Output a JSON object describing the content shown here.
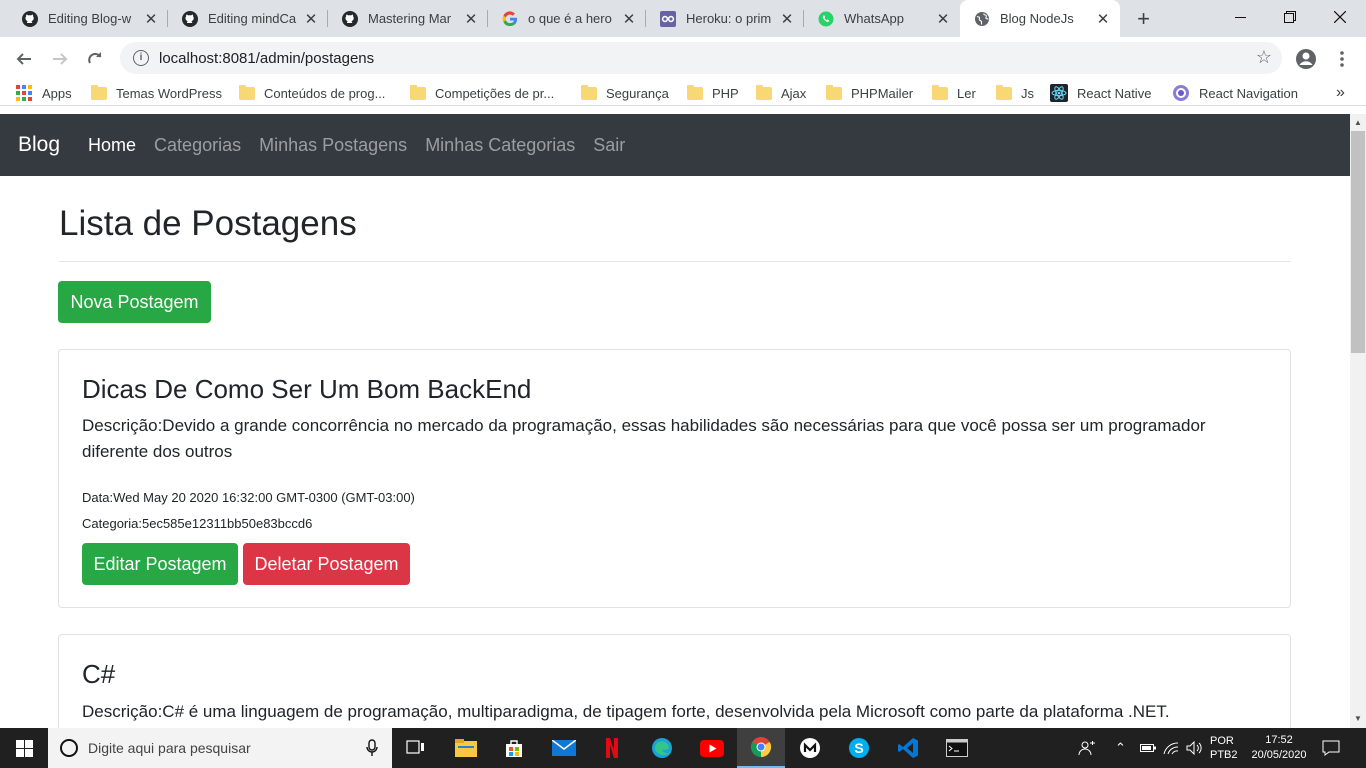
{
  "browser": {
    "tabs": [
      {
        "title": "Editing Blog-w",
        "icon": "github-icon",
        "active": false
      },
      {
        "title": "Editing mindCa",
        "icon": "github-icon",
        "active": false
      },
      {
        "title": "Mastering Mar",
        "icon": "github-icon",
        "active": false
      },
      {
        "title": "o que é a hero",
        "icon": "google-icon",
        "active": false
      },
      {
        "title": "Heroku: o prim",
        "icon": "heroku-icon",
        "active": false
      },
      {
        "title": "WhatsApp",
        "icon": "whatsapp-icon",
        "active": false
      },
      {
        "title": "Blog NodeJs",
        "icon": "globe-icon",
        "active": true
      }
    ],
    "url": "localhost:8081/admin/postagens",
    "bookmarks": [
      {
        "label": "Apps",
        "icon": "apps-grid-icon"
      },
      {
        "label": "Temas WordPress",
        "icon": "folder-icon"
      },
      {
        "label": "Conteúdos de prog...",
        "icon": "folder-icon"
      },
      {
        "label": "Competições de pr...",
        "icon": "folder-icon"
      },
      {
        "label": "Segurança",
        "icon": "folder-icon"
      },
      {
        "label": "PHP",
        "icon": "folder-icon"
      },
      {
        "label": "Ajax",
        "icon": "folder-icon"
      },
      {
        "label": "PHPMailer",
        "icon": "folder-icon"
      },
      {
        "label": "Ler",
        "icon": "folder-icon"
      },
      {
        "label": "Js",
        "icon": "folder-icon"
      },
      {
        "label": "React Native",
        "icon": "react-icon"
      },
      {
        "label": "React Navigation",
        "icon": "react-navigation-icon"
      }
    ],
    "more_bookmarks": "»"
  },
  "navbar": {
    "brand": "Blog",
    "links": [
      "Home",
      "Categorias",
      "Minhas Postagens",
      "Minhas Categorias",
      "Sair"
    ]
  },
  "main": {
    "heading": "Lista de Postagens",
    "new_button": "Nova Postagem",
    "posts": [
      {
        "title": "Dicas De Como Ser Um Bom BackEnd",
        "description": "Descrição:Devido a grande concorrência no mercado da programação, essas habilidades são necessárias para que você possa ser um programador diferente dos outros",
        "date": "Data:Wed May 20 2020 16:32:00 GMT-0300 (GMT-03:00)",
        "category": "Categoria:5ec585e12311bb50e83bccd6",
        "edit_button": "Editar Postagem",
        "delete_button": "Deletar Postagem"
      },
      {
        "title": "C#",
        "description": "Descrição:C# é uma linguagem de programação, multiparadigma, de tipagem forte, desenvolvida pela Microsoft como parte da plataforma .NET."
      }
    ]
  },
  "taskbar": {
    "search_placeholder": "Digite aqui para pesquisar",
    "language": "POR",
    "keyboard": "PTB2",
    "time": "17:52",
    "date": "20/05/2020"
  },
  "colors": {
    "navbar": "#343a40",
    "success": "#28a745",
    "danger": "#dc3545"
  }
}
